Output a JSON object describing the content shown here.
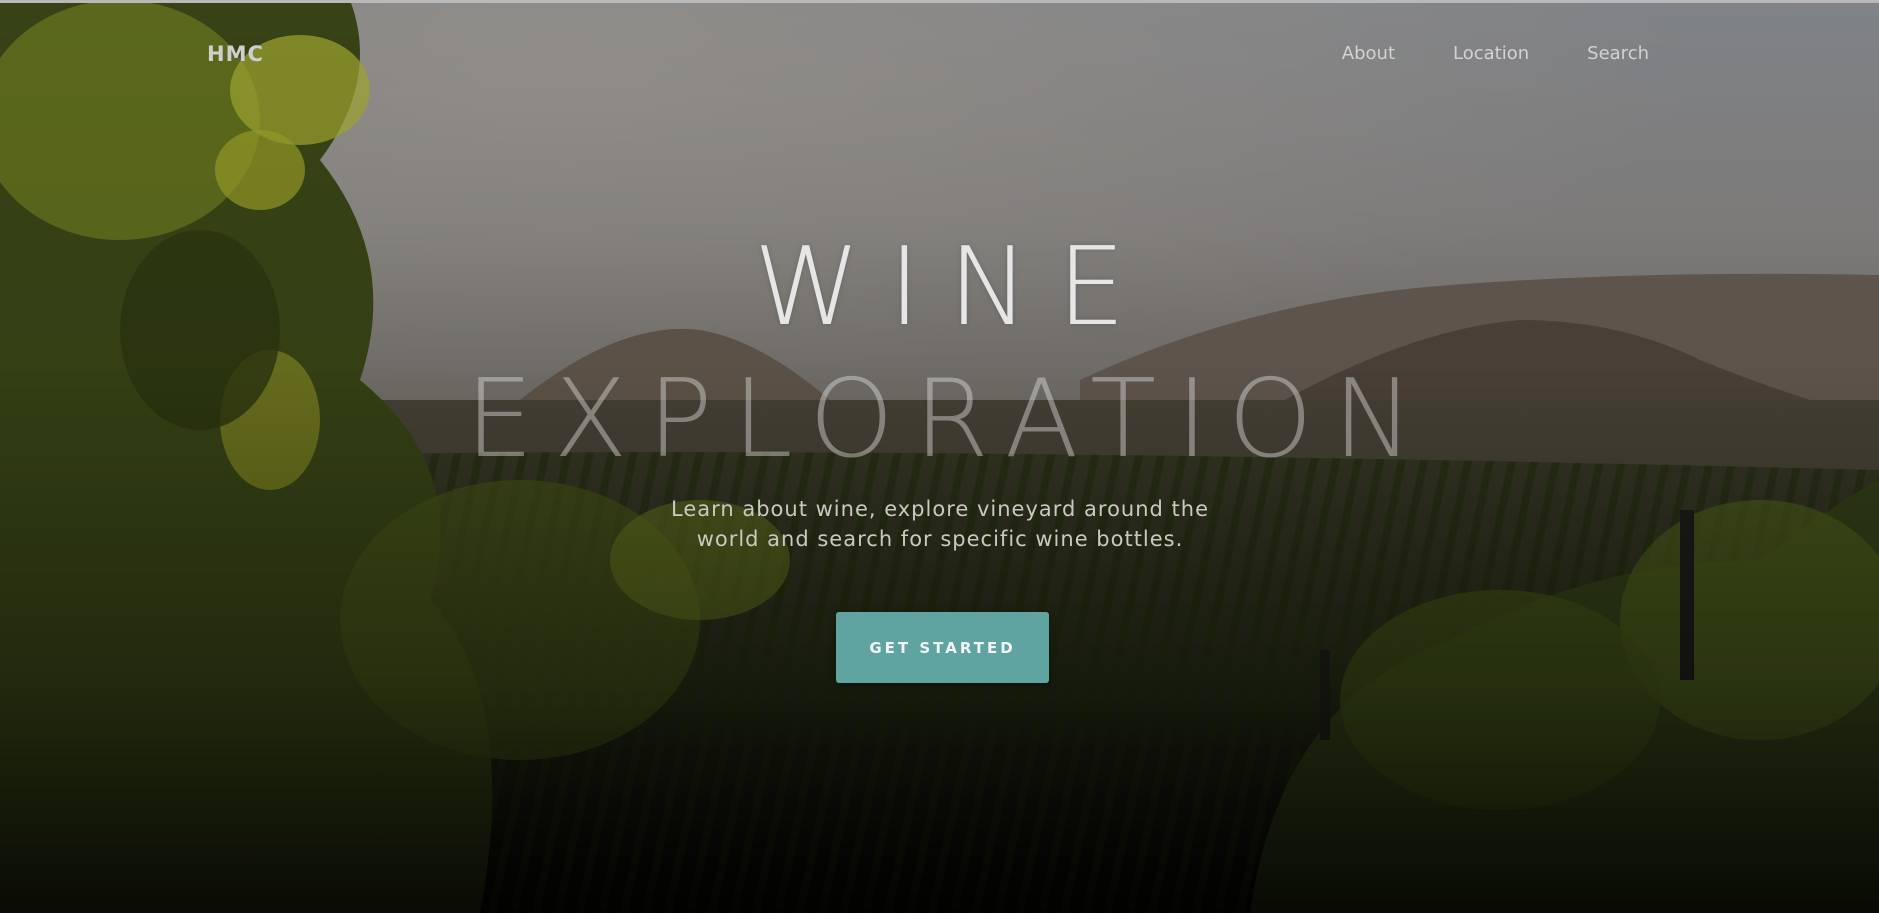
{
  "nav": {
    "logo": "HMC",
    "links": [
      "About",
      "Location",
      "Search"
    ]
  },
  "hero": {
    "title_line1": "WINE",
    "title_line2": "EXPLORATION",
    "subtitle_line1": "Learn about wine, explore vineyard around the",
    "subtitle_line2": "world and search for specific wine bottles.",
    "cta_label": "GET STARTED",
    "image_description": "vineyard at sunset with hills and grapevine leaves"
  },
  "colors": {
    "accent": "#5fa4a0",
    "nav_text": "#d2d2d2",
    "title_text": "#e6e6e6"
  }
}
